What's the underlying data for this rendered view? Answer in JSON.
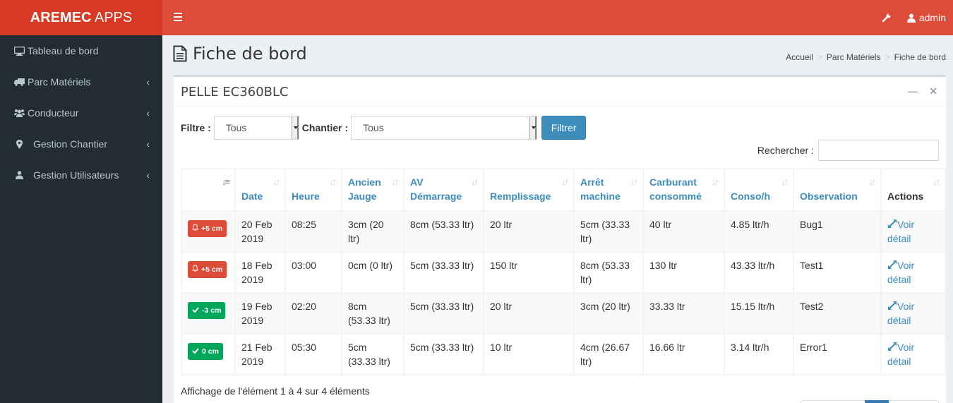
{
  "app": {
    "logo_bold": "AREMEC",
    "logo_light": " APPS"
  },
  "navbar": {
    "user": "admin"
  },
  "sidebar": {
    "items": [
      {
        "label": "Tableau de bord",
        "icon": "desktop-icon",
        "has_children": false
      },
      {
        "label": "Parc Matériels",
        "icon": "truck-icon",
        "has_children": true
      },
      {
        "label": "Conducteur",
        "icon": "users-icon",
        "has_children": true
      },
      {
        "label": "Gestion Chantier",
        "icon": "map-marker-icon",
        "has_children": true
      },
      {
        "label": "Gestion Utilisateurs",
        "icon": "user-icon",
        "has_children": true
      }
    ]
  },
  "page": {
    "title": "Fiche de bord",
    "breadcrumb": [
      "Accueil",
      "Parc Matériels",
      "Fiche de bord"
    ]
  },
  "box": {
    "title": "PELLE EC360BLC",
    "filter_label": "Filtre :",
    "filter_value": "Tous",
    "chantier_label": "Chantier :",
    "chantier_value": "Tous",
    "filter_button": "Filtrer",
    "search_label": "Rechercher :",
    "search_value": ""
  },
  "table": {
    "headers": [
      {
        "label": "",
        "line2": ""
      },
      {
        "label": "",
        "line2": "Date"
      },
      {
        "label": "",
        "line2": "Heure"
      },
      {
        "label": "Ancien",
        "line2": "Jauge"
      },
      {
        "label": "AV",
        "line2": "Démarrage"
      },
      {
        "label": "",
        "line2": "Remplissage"
      },
      {
        "label": "Arrêt",
        "line2": "machine"
      },
      {
        "label": "Carburant",
        "line2": "consommé"
      },
      {
        "label": "",
        "line2": "Conso/h"
      },
      {
        "label": "",
        "line2": "Observation"
      },
      {
        "label": "",
        "line2": "Actions"
      }
    ],
    "rows": [
      {
        "badge": "+5 cm",
        "status": "alert",
        "date": "20 Feb 2019",
        "heure": "08:25",
        "ancien": "3cm (20 ltr)",
        "av": "8cm (53.33 ltr)",
        "remplissage": "20 ltr",
        "arret": "5cm (33.33 ltr)",
        "carburant": "40 ltr",
        "conso": "4.85 ltr/h",
        "observation": "Bug1",
        "action": "Voir détail"
      },
      {
        "badge": "+5 cm",
        "status": "alert",
        "date": "18 Feb 2019",
        "heure": "03:00",
        "ancien": "0cm (0 ltr)",
        "av": "5cm (33.33 ltr)",
        "remplissage": "150 ltr",
        "arret": "8cm (53.33 ltr)",
        "carburant": "130 ltr",
        "conso": "43.33 ltr/h",
        "observation": "Test1",
        "action": "Voir détail"
      },
      {
        "badge": "-3 cm",
        "status": "ok",
        "date": "19 Feb 2019",
        "heure": "02:20",
        "ancien": "8cm (53.33 ltr)",
        "av": "5cm (33.33 ltr)",
        "remplissage": "20 ltr",
        "arret": "3cm (20 ltr)",
        "carburant": "33.33 ltr",
        "conso": "15.15 ltr/h",
        "observation": "Test2",
        "action": "Voir détail"
      },
      {
        "badge": "0 cm",
        "status": "ok",
        "date": "21 Feb 2019",
        "heure": "05:30",
        "ancien": "5cm (33.33 ltr)",
        "av": "5cm (33.33 ltr)",
        "remplissage": "10 ltr",
        "arret": "4cm (26.67 ltr)",
        "carburant": "16.66 ltr",
        "conso": "3.14 ltr/h",
        "observation": "Error1",
        "action": "Voir détail"
      }
    ],
    "info": "Affichage de l'élément 1 à 4 sur 4 éléments"
  },
  "colors": {
    "header": "#dd4b39",
    "logo": "#d73925",
    "sidebar": "#222d32",
    "primary": "#3c8dbc",
    "danger": "#dd4b39",
    "success": "#00a65a"
  }
}
